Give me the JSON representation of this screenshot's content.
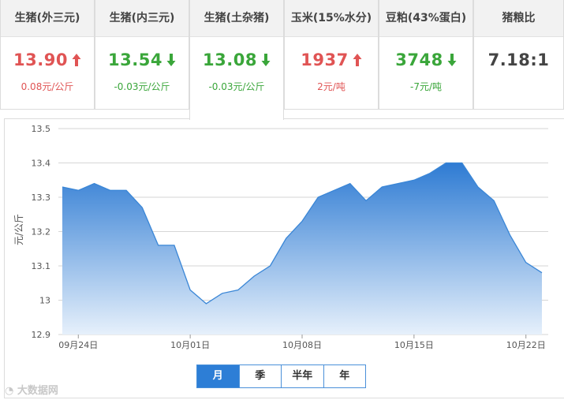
{
  "cards": [
    {
      "title": "生猪(外三元)",
      "price": "13.90",
      "change": "0.08元/公斤",
      "trend": "up"
    },
    {
      "title": "生猪(内三元)",
      "price": "13.54",
      "change": "-0.03元/公斤",
      "trend": "down"
    },
    {
      "title": "生猪(土杂猪)",
      "price": "13.08",
      "change": "-0.03元/公斤",
      "trend": "down"
    },
    {
      "title": "玉米(15%水分)",
      "price": "1937",
      "change": "2元/吨",
      "trend": "up"
    },
    {
      "title": "豆粕(43%蛋白)",
      "price": "3748",
      "change": "-7元/吨",
      "trend": "down"
    },
    {
      "title": "猪粮比",
      "price": "7.18:1",
      "change": "",
      "trend": "neutral"
    }
  ],
  "colors": {
    "up": "#e05454",
    "down": "#3aa63a",
    "accent": "#2d7ed6",
    "area_top": "#2e7bd3",
    "area_bottom": "#e6f0fb",
    "grid": "#d6d6d6"
  },
  "tabs": [
    {
      "label": "月",
      "active": true
    },
    {
      "label": "季",
      "active": false
    },
    {
      "label": "半年",
      "active": false
    },
    {
      "label": "年",
      "active": false
    }
  ],
  "watermark": "大数据网",
  "chart_data": {
    "type": "area",
    "title": "",
    "xlabel": "",
    "ylabel": "元/公斤",
    "ylim": [
      12.9,
      13.5
    ],
    "yticks": [
      12.9,
      13,
      13.1,
      13.2,
      13.3,
      13.4,
      13.5
    ],
    "ytick_labels": [
      "12.9",
      "13",
      "13.1",
      "13.2",
      "13.3",
      "13.4",
      "13.5"
    ],
    "xtick_labels": [
      "09月24日",
      "10月01日",
      "10月08日",
      "10月15日",
      "10月22日"
    ],
    "grid": true,
    "series": [
      {
        "name": "",
        "x": [
          "09-23",
          "09-24",
          "09-25",
          "09-26",
          "09-27",
          "09-28",
          "09-29",
          "09-30",
          "10-01",
          "10-02",
          "10-03",
          "10-04",
          "10-05",
          "10-06",
          "10-07",
          "10-08",
          "10-09",
          "10-10",
          "10-11",
          "10-12",
          "10-13",
          "10-14",
          "10-15",
          "10-16",
          "10-17",
          "10-18",
          "10-19",
          "10-20",
          "10-21",
          "10-22",
          "10-23"
        ],
        "values": [
          13.33,
          13.32,
          13.34,
          13.32,
          13.32,
          13.27,
          13.16,
          13.16,
          13.03,
          12.99,
          13.02,
          13.03,
          13.07,
          13.1,
          13.18,
          13.23,
          13.3,
          13.32,
          13.34,
          13.29,
          13.33,
          13.34,
          13.35,
          13.37,
          13.4,
          13.4,
          13.33,
          13.29,
          13.19,
          13.11,
          13.08
        ]
      }
    ]
  }
}
